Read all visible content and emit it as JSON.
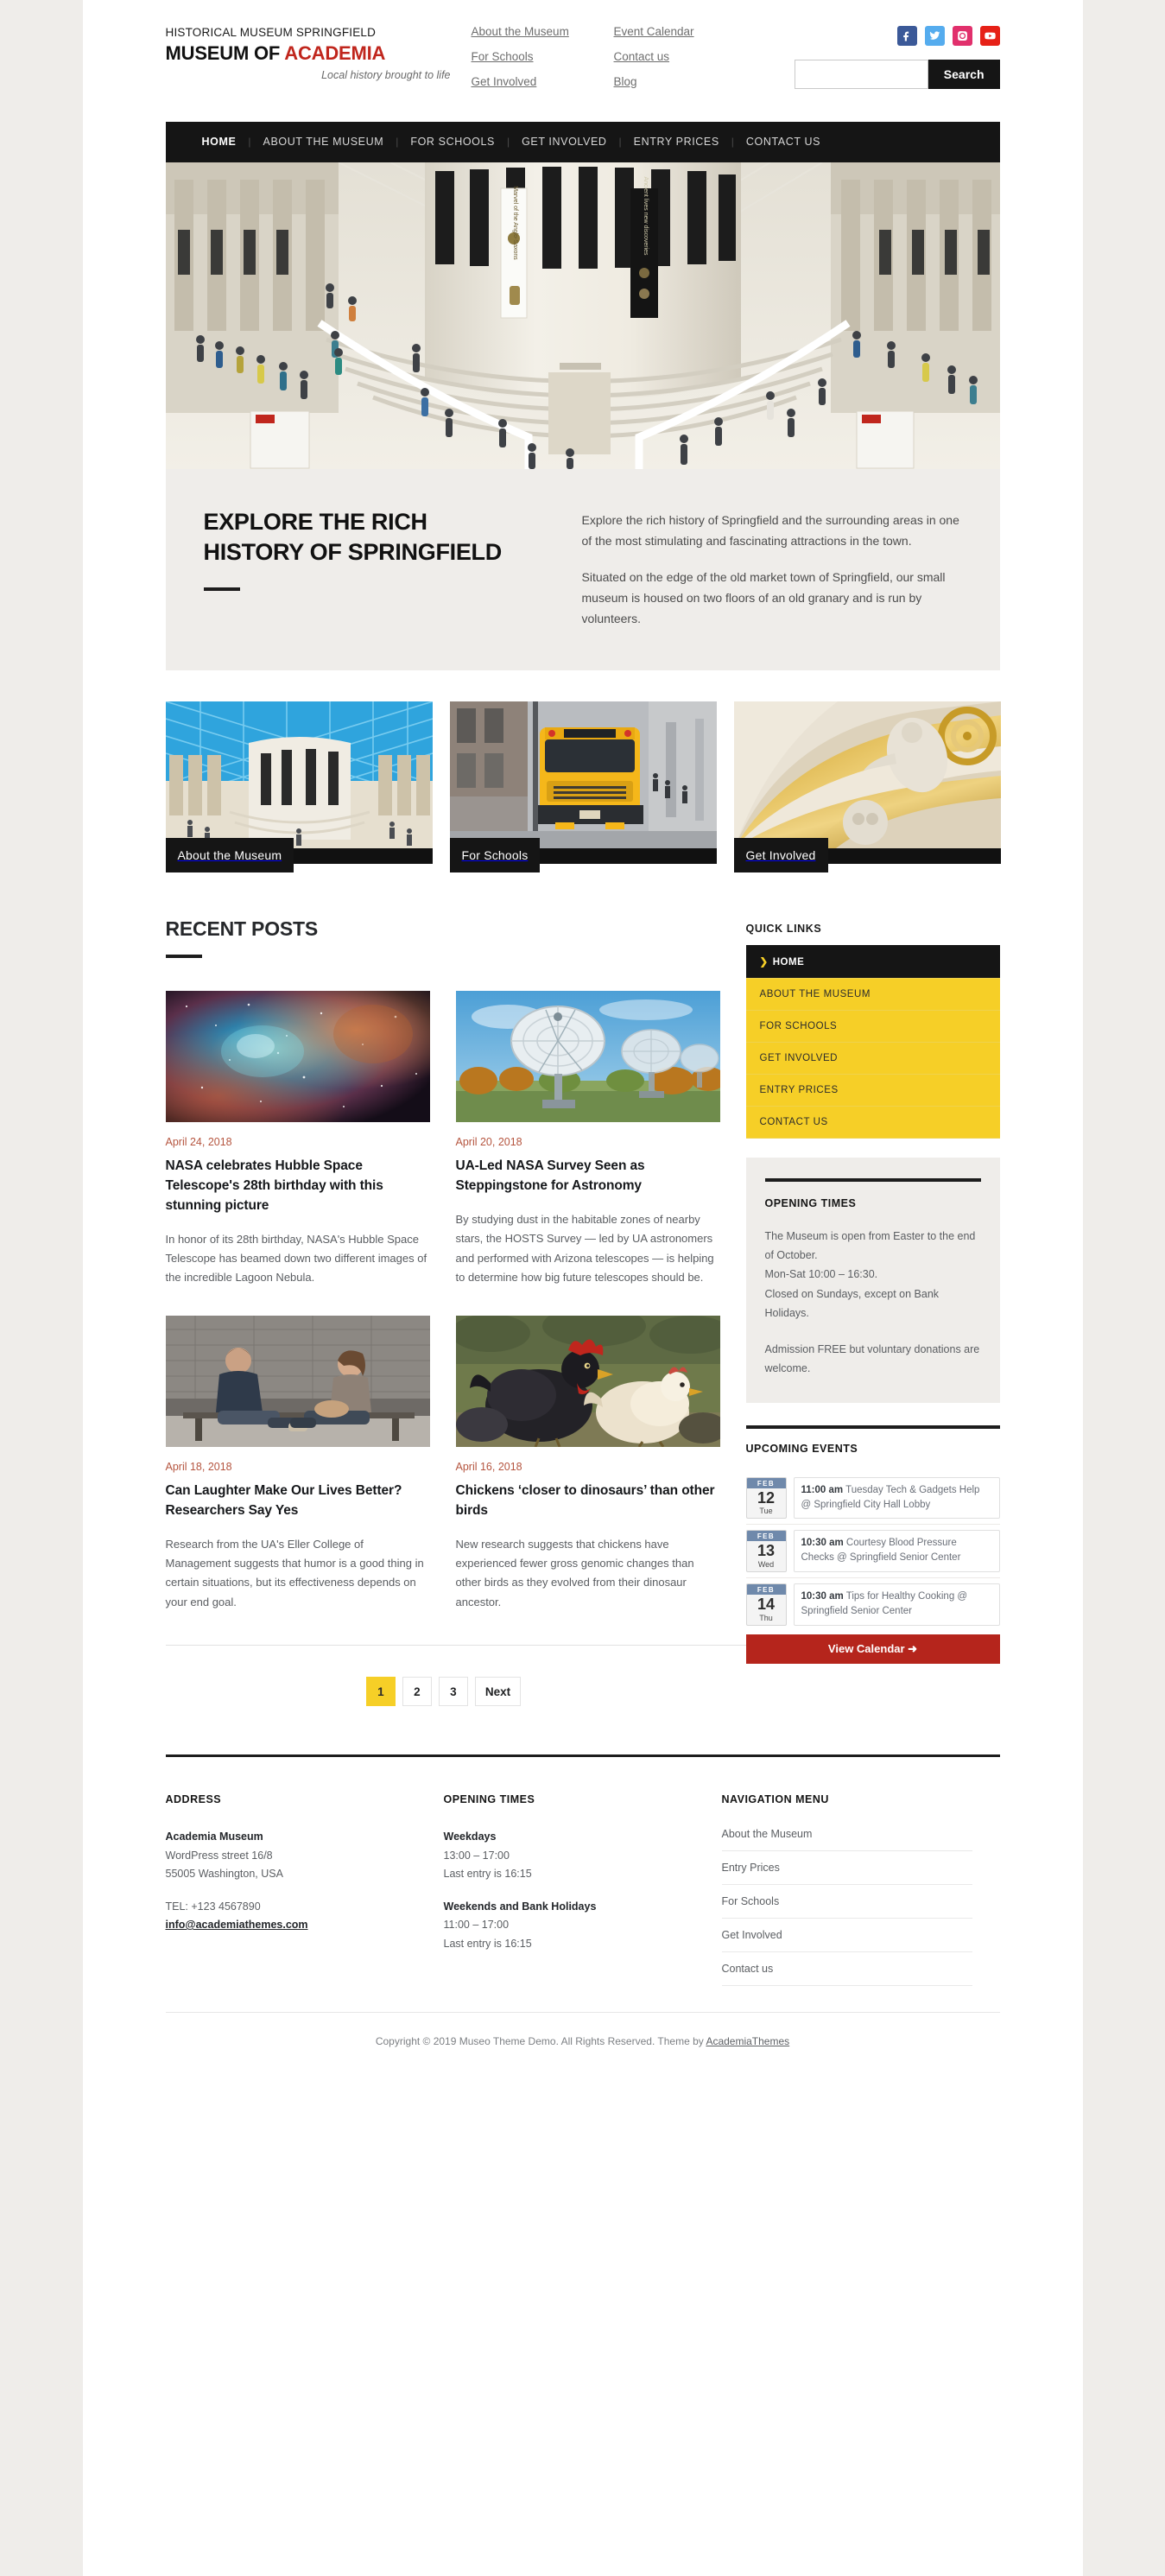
{
  "header": {
    "eyebrow": "HISTORICAL MUSEUM SPRINGFIELD",
    "title_main": "MUSEUM OF ",
    "title_accent": "ACADEMIA",
    "tagline": "Local history brought to life",
    "links_col1": [
      "About the Museum",
      "For Schools",
      "Get Involved"
    ],
    "links_col2": [
      "Event Calendar",
      "Contact us",
      "Blog"
    ],
    "social": [
      "facebook-icon",
      "twitter-icon",
      "instagram-icon",
      "youtube-icon"
    ],
    "search": {
      "value": "",
      "placeholder": "",
      "button_label": "Search"
    }
  },
  "mainnav": {
    "items": [
      "HOME",
      "ABOUT THE MUSEUM",
      "FOR SCHOOLS",
      "GET INVOLVED",
      "ENTRY PRICES",
      "CONTACT US"
    ],
    "active": "HOME"
  },
  "intro": {
    "heading_line1": "EXPLORE THE RICH",
    "heading_line2": "HISTORY OF SPRINGFIELD",
    "paragraph1": "Explore the rich history of Springfield and the surrounding areas in one of the most stimulating and fascinating attractions in the town.",
    "paragraph2": "Situated on the edge of the old market town of Springfield, our small museum is housed on two floors of an old granary and is run by volunteers."
  },
  "cards": [
    {
      "caption": "About the Museum"
    },
    {
      "caption": "For Schools"
    },
    {
      "caption": "Get Involved"
    }
  ],
  "recent": {
    "title": "RECENT POSTS",
    "posts": [
      {
        "date": "April 24, 2018",
        "title": "NASA celebrates Hubble Space Telescope's 28th birthday with this stunning picture",
        "excerpt": "In honor of its 28th birthday, NASA's Hubble Space Telescope has beamed down two different images of the incredible Lagoon Nebula."
      },
      {
        "date": "April 20, 2018",
        "title": "UA-Led NASA Survey Seen as Steppingstone for Astronomy",
        "excerpt": "By studying dust in the habitable zones of nearby stars, the HOSTS Survey — led by UA astronomers and performed with Arizona telescopes — is helping to determine how big future telescopes should be."
      },
      {
        "date": "April 18, 2018",
        "title": "Can Laughter Make Our Lives Better? Researchers Say Yes",
        "excerpt": "Research from the UA's Eller College of Management suggests that humor is a good thing in certain situations, but its effectiveness depends on your end goal."
      },
      {
        "date": "April 16, 2018",
        "title": "Chickens ‘closer to dinosaurs’ than other birds",
        "excerpt": "New research suggests that chickens have experienced fewer gross genomic changes than other birds as they evolved from their dinosaur ancestor."
      }
    ]
  },
  "pagination": {
    "pages": [
      "1",
      "2",
      "3"
    ],
    "next_label": "Next",
    "current": "1"
  },
  "sidebar": {
    "quick_links_title": "QUICK LINKS",
    "quick_links": [
      {
        "label": "HOME",
        "active": true
      },
      {
        "label": "ABOUT THE MUSEUM",
        "active": false
      },
      {
        "label": "FOR SCHOOLS",
        "active": false
      },
      {
        "label": "GET INVOLVED",
        "active": false
      },
      {
        "label": "ENTRY PRICES",
        "active": false
      },
      {
        "label": "CONTACT US",
        "active": false
      }
    ],
    "opening_times": {
      "title": "OPENING TIMES",
      "paragraph1": "The Museum is open from Easter to the end of October.\nMon-Sat 10:00 – 16:30.\nClosed on Sundays, except on Bank Holidays.",
      "paragraph2": "Admission FREE but voluntary donations are welcome."
    },
    "upcoming_events": {
      "title": "UPCOMING EVENTS",
      "events": [
        {
          "month": "FEB",
          "day": "12",
          "weekday": "Tue",
          "time": "11:00 am",
          "text": " Tuesday Tech & Gadgets Help @ Springfield City Hall Lobby"
        },
        {
          "month": "FEB",
          "day": "13",
          "weekday": "Wed",
          "time": "10:30 am",
          "text": " Courtesy Blood Pressure Checks @ Springfield Senior Center"
        },
        {
          "month": "FEB",
          "day": "14",
          "weekday": "Thu",
          "time": "10:30 am",
          "text": " Tips for Healthy Cooking @ Springfield Senior Center"
        }
      ],
      "view_calendar_label": "View Calendar ➜"
    }
  },
  "footer": {
    "address": {
      "title": "ADDRESS",
      "name": "Academia Museum",
      "street": "WordPress street 16/8",
      "city": "55005 Washington, USA",
      "tel": "TEL: +123 4567890",
      "email": "info@academiathemes.com"
    },
    "opening": {
      "title": "OPENING TIMES",
      "weekdays_label": "Weekdays",
      "weekdays_hours": "13:00 – 17:00",
      "weekdays_last": "Last entry is 16:15",
      "weekends_label": "Weekends and Bank Holidays",
      "weekends_hours": "11:00 – 17:00",
      "weekends_last": "Last entry is 16:15"
    },
    "nav": {
      "title": "NAVIGATION MENU",
      "items": [
        "About the Museum",
        "Entry Prices",
        "For Schools",
        "Get Involved",
        "Contact us"
      ]
    },
    "copyright_pre": "Copyright © 2019 Museo Theme Demo. All Rights Reserved. Theme by ",
    "copyright_link": "AcademiaThemes"
  },
  "colors": {
    "accent_yellow": "#f6cf27",
    "accent_red": "#c0261d",
    "dark": "#151515",
    "date_text": "#b5553f",
    "panel_bg": "#efedea"
  }
}
